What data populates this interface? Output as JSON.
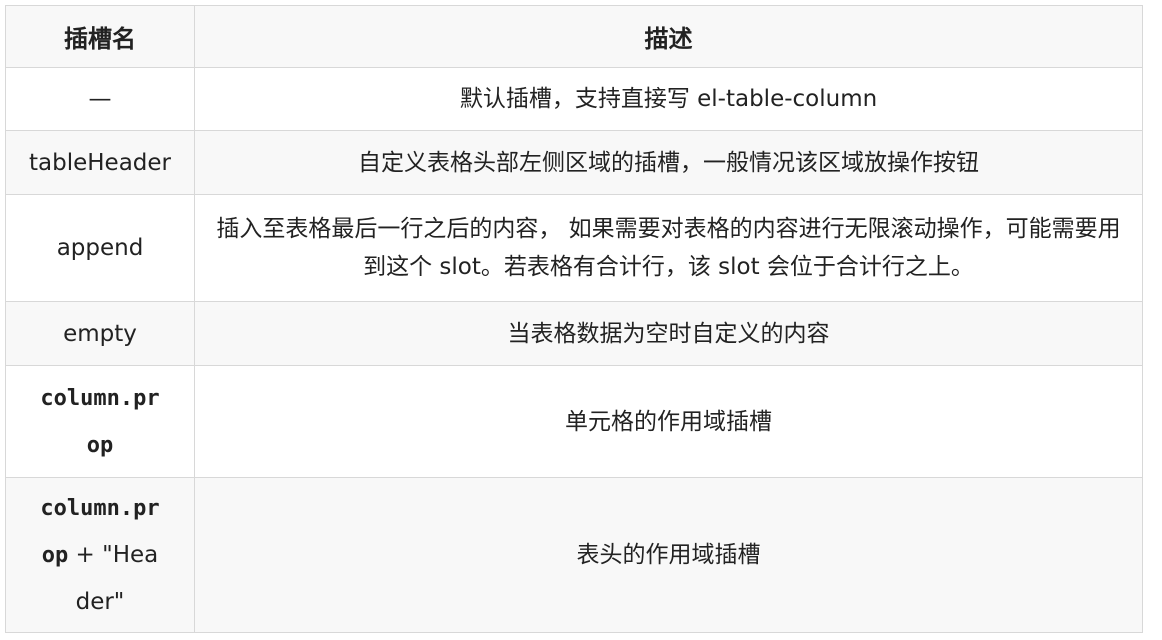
{
  "table": {
    "headers": {
      "name": "插槽名",
      "description": "描述"
    },
    "rows": [
      {
        "name": "—",
        "description": "默认插槽，支持直接写 el-table-column"
      },
      {
        "name": "tableHeader",
        "description": "自定义表格头部左侧区域的插槽，一般情况该区域放操作按钮"
      },
      {
        "name": "append",
        "description": "插入至表格最后一行之后的内容， 如果需要对表格的内容进行无限滚动操作，可能需要用到这个 slot。若表格有合计行，该 slot 会位于合计行之上。"
      },
      {
        "name": "empty",
        "description": "当表格数据为空时自定义的内容"
      },
      {
        "name_code": "column.prop",
        "description": "单元格的作用域插槽"
      },
      {
        "name_code": "column.prop",
        "name_suffix": " + \"Header\"",
        "description": "表头的作用域插槽"
      }
    ]
  }
}
